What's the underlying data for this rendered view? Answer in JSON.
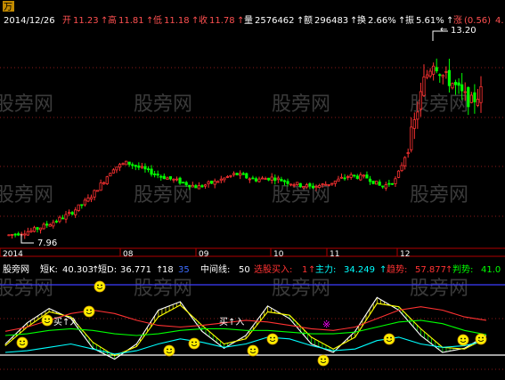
{
  "header": {
    "stock_name": "万 科A",
    "date": "2014/12/26",
    "open_label": "开",
    "open": "11.23",
    "high_label": "高",
    "high": "11.81",
    "low_label": "低",
    "low": "11.18",
    "close_label": "收",
    "close": "11.78",
    "volume_label": "量",
    "volume": "2576462",
    "amount_label": "额",
    "amount": "296483",
    "turnover_label": "换",
    "turnover": "2.66%",
    "amplitude_label": "振",
    "amplitude": "5.61%",
    "change_label": "涨",
    "change": "(0.56)",
    "change_tail": "4."
  },
  "price_chart": {
    "high_marker": "13.20",
    "low_marker": "7.96",
    "months": [
      "2014",
      "08",
      "09",
      "10",
      "11",
      "12"
    ]
  },
  "indicator_header": {
    "name": "股旁网",
    "short_k_label": "短K:",
    "short_k": "40.303",
    "short_d_label": "短D:",
    "short_d": "36.771",
    "v18": "18",
    "v35": "35",
    "mid_label": "中间线:",
    "mid": "50",
    "select_label": "选股买入:",
    "select": "1",
    "main_label": "主力:",
    "main": "34.249",
    "trend_label": "趋势:",
    "trend": "57.877",
    "judge_label": "判势:",
    "judge": "41.0"
  },
  "annotations": {
    "buy_in_1": "买↑入",
    "buy_in_2": "买↑入"
  },
  "watermark": "股旁网",
  "colors": {
    "up": "#ff3232",
    "down": "#00ff00",
    "label_red": "#ff5050",
    "yellow": "#ffff00",
    "cyan": "#00ffff",
    "white": "#ffffff",
    "grid": "#8a1a1a",
    "purple": "#ff00ff",
    "blue": "#3c6cff"
  },
  "chart_data": [
    {
      "type": "candlestick",
      "title": "万科A",
      "x_labels": [
        "2014",
        "08",
        "09",
        "10",
        "11",
        "12"
      ],
      "ylim": [
        7.7,
        13.5
      ],
      "annotations": {
        "max": 13.2,
        "min": 7.96
      },
      "price_path": [
        [
          0,
          7.98
        ],
        [
          0.02,
          8.03
        ],
        [
          0.05,
          8.1
        ],
        [
          0.09,
          8.3
        ],
        [
          0.13,
          8.55
        ],
        [
          0.17,
          8.95
        ],
        [
          0.2,
          9.4
        ],
        [
          0.22,
          9.75
        ],
        [
          0.25,
          9.9
        ],
        [
          0.28,
          9.75
        ],
        [
          0.32,
          9.55
        ],
        [
          0.36,
          9.4
        ],
        [
          0.4,
          9.25
        ],
        [
          0.44,
          9.4
        ],
        [
          0.48,
          9.6
        ],
        [
          0.52,
          9.45
        ],
        [
          0.56,
          9.5
        ],
        [
          0.6,
          9.35
        ],
        [
          0.64,
          9.25
        ],
        [
          0.68,
          9.35
        ],
        [
          0.72,
          9.55
        ],
        [
          0.76,
          9.5
        ],
        [
          0.79,
          9.25
        ],
        [
          0.82,
          9.45
        ],
        [
          0.84,
          10.1
        ],
        [
          0.86,
          11.0
        ],
        [
          0.88,
          12.1
        ],
        [
          0.9,
          12.6
        ],
        [
          0.92,
          12.2
        ],
        [
          0.94,
          12.0
        ],
        [
          0.96,
          11.7
        ],
        [
          0.98,
          11.5
        ],
        [
          1.0,
          11.78
        ]
      ]
    },
    {
      "type": "line",
      "title": "股旁网",
      "ylim": [
        0,
        100
      ],
      "series": [
        {
          "name": "短K",
          "values": [
            30,
            55,
            72,
            60,
            25,
            12,
            30,
            70,
            80,
            45,
            25,
            40,
            75,
            60,
            30,
            20,
            45,
            85,
            70,
            40,
            20,
            25,
            40
          ]
        },
        {
          "name": "短D",
          "values": [
            28,
            50,
            68,
            62,
            32,
            16,
            27,
            62,
            76,
            52,
            30,
            36,
            68,
            64,
            38,
            24,
            38,
            78,
            74,
            48,
            26,
            24,
            37
          ]
        },
        {
          "name": "中间线",
          "values": [
            50,
            50,
            50,
            50,
            50,
            50,
            50,
            50,
            50,
            50,
            50,
            50,
            50,
            50,
            50,
            50,
            50,
            50,
            50,
            50,
            50,
            50,
            50
          ]
        },
        {
          "name": "主力",
          "values": [
            20,
            22,
            26,
            30,
            24,
            18,
            22,
            30,
            36,
            32,
            26,
            30,
            38,
            36,
            28,
            22,
            24,
            34,
            38,
            30,
            26,
            28,
            34
          ]
        },
        {
          "name": "趋势",
          "values": [
            45,
            50,
            58,
            66,
            70,
            66,
            58,
            52,
            50,
            52,
            55,
            58,
            56,
            52,
            48,
            46,
            50,
            60,
            70,
            74,
            70,
            62,
            58
          ]
        },
        {
          "name": "判势",
          "values": [
            40,
            42,
            46,
            48,
            46,
            42,
            40,
            42,
            46,
            48,
            48,
            46,
            46,
            44,
            42,
            42,
            44,
            50,
            56,
            58,
            54,
            46,
            41
          ]
        }
      ]
    }
  ]
}
